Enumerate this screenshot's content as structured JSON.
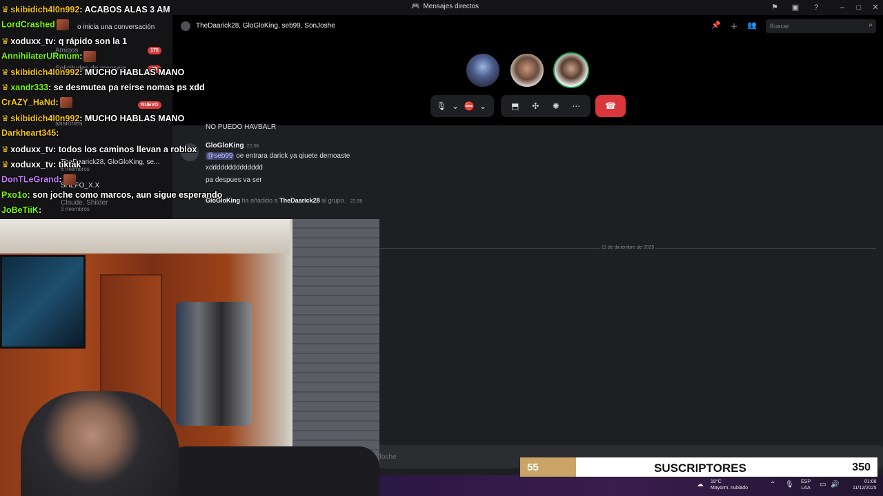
{
  "window": {
    "title": "Mensajes directos",
    "icons": [
      "inbox-icon",
      "screen-icon",
      "help-icon",
      "minimize-icon",
      "maximize-icon",
      "close-icon"
    ]
  },
  "sidebar": {
    "items": [
      {
        "label": "o inicia una conversación"
      },
      {
        "label": "Amigos"
      },
      {
        "label": "Solicitudes de mensaje"
      },
      {
        "label": "Misiones"
      },
      {
        "label": "TheDaarick28, GloGloKing, se..."
      },
      {
        "label": "6 miembros"
      },
      {
        "label": "SHEFO_X.X"
      },
      {
        "label": "Claude, Shilder"
      },
      {
        "label": "3 miembros"
      }
    ],
    "badges": [
      "175",
      "20",
      "NUEVO"
    ]
  },
  "call": {
    "participants": "TheDaarick28, GloGloKing, seb99, SonJoshe",
    "search_placeholder": "Buscar"
  },
  "messages": {
    "partial_line": "NO PUEDO HAVBALR",
    "author": "GloGloKing",
    "time": "22:38",
    "mention": "@seb99",
    "line1": "oe entrara darick ya qiuete demoaste",
    "line2": "xdddddddddddddd",
    "line3": "pa  despues va ser",
    "system": {
      "author": "GloGloKing",
      "action": "ha añadido a",
      "target": "TheDaarick28",
      "suffix": "al grupo.",
      "time": "22:38"
    },
    "date_divider": "11 de diciembre de 2025",
    "composer_placeholder": "Joshe"
  },
  "chat_overlay": [
    {
      "user": "skibidich4l0n992",
      "color": "#f5c518",
      "text": ": ACABOS ALAS 3 AM",
      "crown": true
    },
    {
      "user": "LordCrashed",
      "color": "#7cfc00",
      "text": "",
      "crown": false,
      "emote": true
    },
    {
      "user": "xoduxx_tv",
      "color": "#ffffff",
      "text": ": q rápido son la 1",
      "crown": true
    },
    {
      "user": "AnnihilaterURmum",
      "color": "#7cfc00",
      "text": ":",
      "crown": false,
      "emote": true
    },
    {
      "user": "skibidich4l0n992",
      "color": "#f5c518",
      "text": ": MUCHO HABLAS MANO",
      "crown": true
    },
    {
      "user": "xandr333",
      "color": "#7cfc00",
      "text": ": se desmutea pa reirse nomas ps xdd",
      "crown": true
    },
    {
      "user": "CrAZY_HaNd",
      "color": "#f5c518",
      "text": ":",
      "crown": false,
      "emote": true
    },
    {
      "user": "skibidich4l0n992",
      "color": "#f5c518",
      "text": ": MUCHO HABLAS MANO",
      "crown": true
    },
    {
      "user": "Darkheart345",
      "color": "#f5c518",
      "text": ":",
      "crown": false
    },
    {
      "user": "xoduxx_tv",
      "color": "#ffffff",
      "text": ": todos los caminos llevan a roblox",
      "crown": true
    },
    {
      "user": "xoduxx_tv",
      "color": "#ffffff",
      "text": ": tiktak",
      "crown": true
    },
    {
      "user": "DonTLeGrand",
      "color": "#c77dff",
      "text": ":",
      "crown": false,
      "emote": true
    },
    {
      "user": "Pxo1o",
      "color": "#7cfc00",
      "text": ": son joche como marcos, aun sigue esperando",
      "crown": false
    },
    {
      "user": "JoBeTiiK",
      "color": "#7cfc00",
      "text": ":",
      "crown": false
    }
  ],
  "subs": {
    "current": "55",
    "label": "SUSCRIPTORES",
    "goal": "350",
    "progress": 0.157
  },
  "taskbar": {
    "temp": "19°C",
    "weather": "Mayorm. nublado",
    "lang": "ESP",
    "region": "LAA",
    "time": "01:08",
    "date": "11/12/2025"
  }
}
